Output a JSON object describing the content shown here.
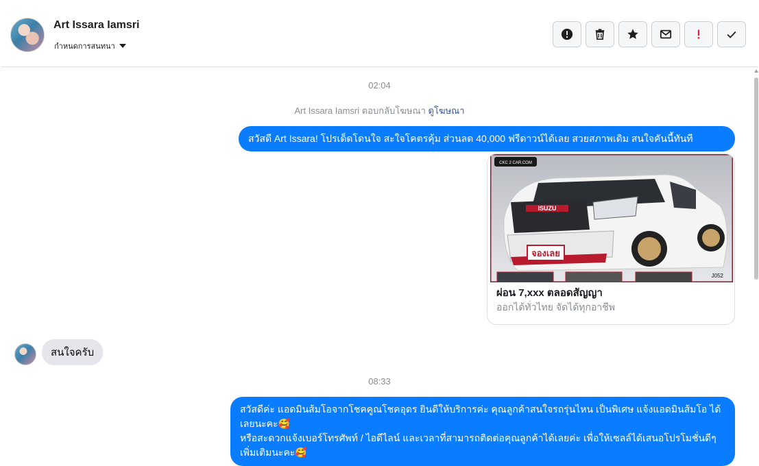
{
  "header": {
    "contact_name": "Art Issara Iamsri",
    "conversation_setting": "กำหนดการสนทนา",
    "toolbar_icons": [
      "alert-circle-icon",
      "trash-icon",
      "star-icon",
      "envelope-icon",
      "exclamation-icon",
      "checkmark-icon"
    ]
  },
  "messages": {
    "timestamp_1": "02:04",
    "reply_note": "Art Issara Iamsri ตอบกลับโฆษณา",
    "reply_note_link": "ดูโฆษณา",
    "outgoing_1": "สวัสดี Art Issara! โปรเด็ดโดนใจ สะใจโคตรคุ้ม ส่วนลด 40,000 ฟรีดาวน์ได้เลย สวยสภาพเดิม สนใจคันนี้ทันที",
    "ad_card": {
      "title": "ผ่อน 7,xxx ตลอดสัญญา",
      "subtitle": "ออกได้ทั่วไทย จัดได้ทุกอาชีพ",
      "image_badge": "จองเลย",
      "image_brand": "ISUZU",
      "image_code": "J052",
      "image_watermark": "CKC 2 CAR.COM"
    },
    "incoming_1": "สนใจครับ",
    "timestamp_2": "08:33",
    "outgoing_2_line1": "สวัสดีค่ะ แอดมินส้มโอจากโชคคูณโชคอุดร ยินดีให้บริการค่ะ   คุณลูกค้าสนใจรถรุ่นไหน เป็นพิเศษ แจ้งแอดมินส้มโอ ได้เลยนะคะ🥰",
    "outgoing_2_line2": "หรือสะดวกแจ้งเบอร์โทรศัพท์ / ไอดีไลน์ และเวลาที่สามารถติดต่อคุณลูกค้าได้เลยค่ะ เพื่อให้เซลล์ได้เสนอโปรโมชั่นดีๆเพิ่มเติมนะคะ🥰"
  },
  "colors": {
    "outgoing_bubble": "#0a7cff",
    "incoming_bubble": "#e4e6eb",
    "spam_red": "#e41e3f"
  }
}
